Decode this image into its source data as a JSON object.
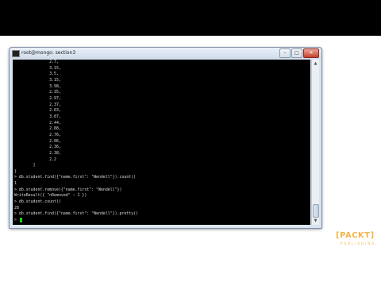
{
  "window": {
    "title": "root@mongo: section3",
    "buttons": {
      "minimize": "–",
      "maximize": "□",
      "close": "✕"
    }
  },
  "terminal": {
    "lines": [
      "               2.7,",
      "               3.15,",
      "               3.5,",
      "               3.15,",
      "               3.98,",
      "               2.35,",
      "               2.97,",
      "               2.37,",
      "               2.03,",
      "               3.87,",
      "               2.44,",
      "               2.88,",
      "               2.76,",
      "               2.06,",
      "               2.36,",
      "               2.38,",
      "               2.2",
      "        ]",
      "}",
      "> db.student.find({\"name.first\": \"Wendell\"}).count()",
      "1",
      "> db.student.remove({\"name.first\": \"Wendell\"})",
      "WriteResult({ \"nRemoved\" : 1 })",
      "> db.student.count()",
      "28",
      "> db.student.find({\"name.first\": \"Wendell\"}).pretty()",
      "> "
    ]
  },
  "scrollbar": {
    "up_icon": "▲",
    "down_icon": "▼"
  },
  "logo": {
    "main": "[PACKT]",
    "sub": "PUBLISHING"
  },
  "colors": {
    "terminal_bg": "#000000",
    "terminal_text": "#dcdcdc",
    "cursor": "#19d219",
    "logo": "#f3b54a"
  }
}
